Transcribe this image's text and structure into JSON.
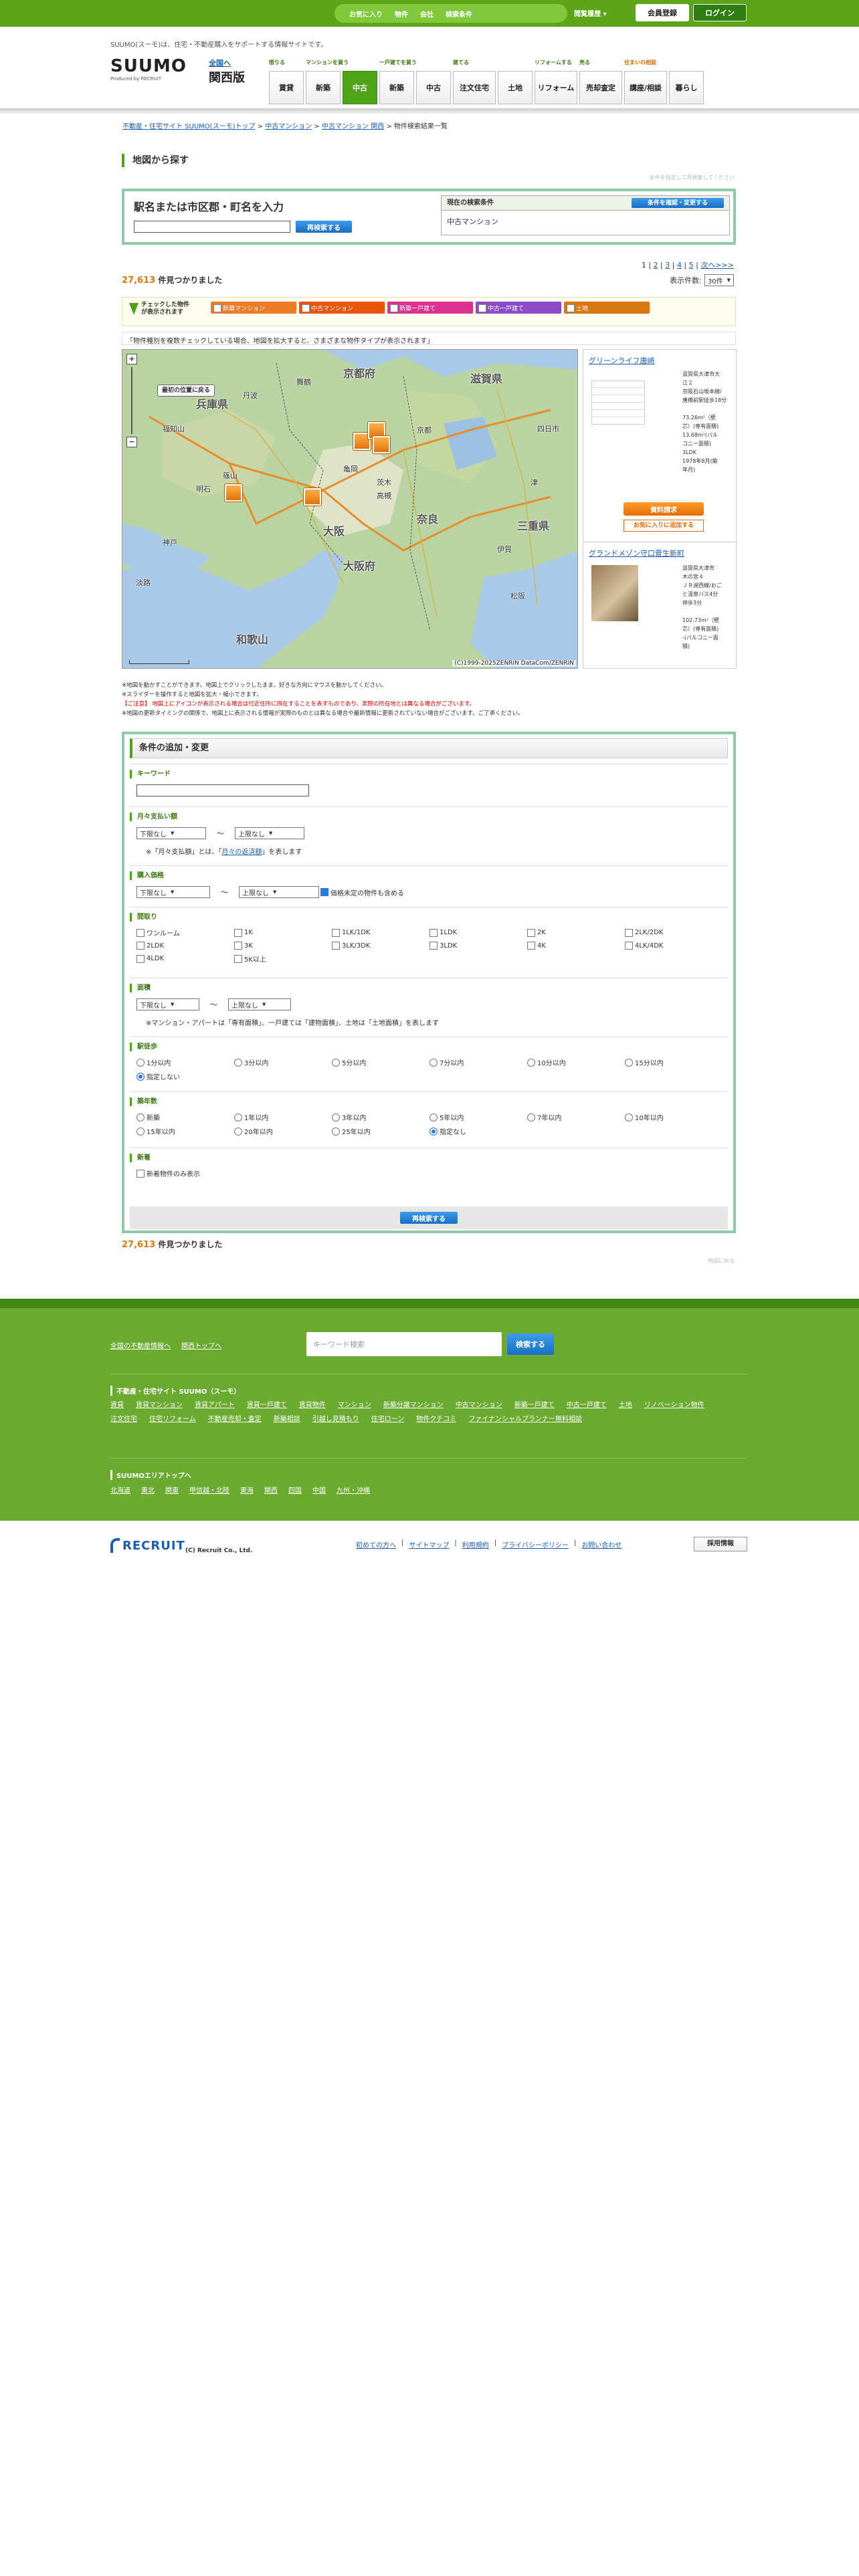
{
  "topbar": {
    "favorites": "お気に入り",
    "properties": "物件",
    "companies": "会社",
    "conditions": "検索条件",
    "history": "閲覧履歴",
    "register": "会員登録",
    "login": "ログイン"
  },
  "header": {
    "tagline": "SUUMO(スーモ)は、住宅・不動産購入をサポートする情報サイトです。",
    "logo": "SUUMO",
    "logo_sub": "Produced by RECRUIT",
    "region_link": "全国へ",
    "region": "関西版"
  },
  "nav": [
    {
      "caption": "借りる",
      "items": [
        "賃貸"
      ]
    },
    {
      "caption": "マンションを買う",
      "items": [
        "新築",
        "中古"
      ]
    },
    {
      "caption": "一戸建てを買う",
      "items": [
        "新築",
        "中古"
      ]
    },
    {
      "caption": "建てる",
      "items": [
        "注文住宅",
        "土地"
      ]
    },
    {
      "caption": "リフォームする",
      "items": [
        "リフォーム"
      ]
    },
    {
      "caption": "売る",
      "items": [
        "売却査定"
      ]
    },
    {
      "caption": "住まいの相談",
      "items": [
        "講座/相談"
      ]
    },
    {
      "caption": "",
      "items": [
        "暮らし"
      ]
    }
  ],
  "breadcrumb": {
    "items": [
      "不動産・住宅サイト SUUMO(スーモ)トップ",
      "中古マンション",
      "中古マンション 関西"
    ],
    "current": "物件検索結果一覧"
  },
  "section": {
    "title": "地図から探す",
    "hint": "条件を指定して再検索してください"
  },
  "search": {
    "label": "駅名または市区郡・町名を入力",
    "button": "再検索する",
    "current_header": "現在の検索条件",
    "change_button": "条件を確認・変更する",
    "current_value": "中古マンション"
  },
  "pager": {
    "pages": [
      "1",
      "2",
      "3",
      "4",
      "5"
    ],
    "next": "次へ>>>"
  },
  "results": {
    "count": "27,613",
    "count_suffix": "件見つかりました",
    "per_page_label": "表示件数:",
    "per_page": "30件"
  },
  "typebar": {
    "label": "チェックした物件が表示されます",
    "chips": [
      "新築マンション",
      "中古マンション",
      "新築一戸建て",
      "中古一戸建て",
      "土地"
    ],
    "chip_colors": [
      "#f07b27",
      "#e8550d",
      "#d9338f",
      "#8c4bc8",
      "#d9770f"
    ]
  },
  "map_note": "「物件種別を複数チェックしている場合、地図を拡大すると、さまざまな物件タイプが表示されます」",
  "map": {
    "reset_button": "最初の位置に戻る",
    "copyright": "(C)1999-2025ZENRIN DataCom/ZENRIN",
    "place_labels": [
      "京都府",
      "兵庫県",
      "大阪",
      "奈良",
      "和歌山",
      "大阪府",
      "三重県",
      "滋賀県",
      "福知山",
      "舞鶴",
      "篠山",
      "京都",
      "神戸",
      "亀岡",
      "茨木",
      "高槻",
      "四日市",
      "津",
      "伊賀",
      "松阪",
      "丹波",
      "明石",
      "淡路"
    ],
    "markers": [
      {
        "lat": 35.02,
        "lng": 135.72
      },
      {
        "lat": 35.08,
        "lng": 135.78
      },
      {
        "lat": 35.0,
        "lng": 135.8
      },
      {
        "lat": 34.72,
        "lng": 135.2
      },
      {
        "lat": 34.7,
        "lng": 135.52
      }
    ]
  },
  "properties": [
    {
      "name": "グリーンライフ唐崎",
      "details": [
        "滋賀県大津市大",
        "江２",
        "京阪石山坂本線/",
        "唐橋前駅徒歩18分",
        "",
        "73.26m²（壁",
        "芯）(専有面積)",
        "13.68m²(バル",
        "コニー面積)",
        "3LDK",
        "1978年8月(築",
        "年月)"
      ],
      "button1": "資料請求",
      "button2": "お気に入りに追加する"
    },
    {
      "name": "グランドメゾン守口菅生新町",
      "details": [
        "滋賀県大津市",
        "木の宮４",
        "ＪＲ湖西線/おご",
        "と温泉バス4分",
        "停歩3分",
        "",
        "102.73m²（壁",
        "芯）(専有面積)",
        "-(バルコニー面",
        "積)"
      ]
    }
  ],
  "notes": [
    "※地図を動かすことができます。地図上でクリックしたまま、好きな方向にマウスを動かしてください。",
    "※スライダーを操作すると地図を拡大・縮小できます。",
    "【ご注意】 地図上にアイコンが表示される場合は付近住所に所在することを表すものであり、実際の所在地とは異なる場合がございます。",
    "※地図の更新タイミングの関係で、地図上に表示される情報が実際のものとは異なる場合や最新情報に更新されていない場合がございます。ご了承ください。"
  ],
  "form": {
    "title": "条件の追加・変更",
    "keyword_label": "キーワード",
    "monthly_label": "月々支払い額",
    "monthly_min": "下限なし",
    "monthly_max": "上限なし",
    "monthly_note_prefix": "※「月々支払額」とは、「",
    "monthly_note_link": "月々の返済額",
    "monthly_note_suffix": "」を表します",
    "price_label": "購入価格",
    "price_min": "下限なし",
    "price_max": "上限なし",
    "price_undecided": "価格未定の物件も含める",
    "layout_label": "間取り",
    "layouts": [
      "ワンルーム",
      "1K",
      "1LK/1DK",
      "1LDK",
      "2K",
      "2LK/2DK",
      "2LDK",
      "3K",
      "3LK/3DK",
      "3LDK",
      "4K",
      "4LK/4DK",
      "4LDK",
      "5K以上"
    ],
    "area_label": "面積",
    "area_min": "下限なし",
    "area_max": "上限なし",
    "area_note": "※マンション・アパートは「専有面積」、一戸建ては「建物面積」、土地は「土地面積」を表します",
    "walk_label": "駅徒歩",
    "walk": [
      "1分以内",
      "3分以内",
      "5分以内",
      "7分以内",
      "10分以内",
      "15分以内",
      "指定しない"
    ],
    "walk_selected": 6,
    "age_label": "築年数",
    "ages": [
      "新築",
      "1年以内",
      "3年以内",
      "5年以内",
      "7年以内",
      "10年以内",
      "15年以内",
      "20年以内",
      "25年以内",
      "指定なし"
    ],
    "age_selected": 9,
    "new_label": "新着",
    "new_only": "新着物件のみ表示",
    "submit": "再検索する"
  },
  "page_top": "地図に戻る",
  "footer": {
    "links_top": [
      "全国の不動産情報へ",
      "関西トップへ"
    ],
    "search_placeholder": "キーワード検索",
    "search_button": "検索する",
    "site_heading": "不動産・住宅サイト SUUMO（スーモ）",
    "site_links": [
      "賃貸",
      "賃貸マンション",
      "賃貸アパート",
      "賃貸一戸建て",
      "賃貸物件",
      "マンション",
      "新築分譲マンション",
      "中古マンション",
      "新築一戸建て",
      "中古一戸建て",
      "土地",
      "リノベーション物件",
      "注文住宅",
      "住宅リフォーム",
      "不動産売却・査定",
      "新築相談",
      "引越し見積もり",
      "住宅ローン",
      "物件クチコミ",
      "ファイナンシャルプランナー無料相談"
    ],
    "regions_heading": "SUUMOエリアトップへ",
    "regions": [
      "北海道",
      "東北",
      "関東",
      "甲信越・北陸",
      "東海",
      "関西",
      "四国",
      "中国",
      "九州・沖縄"
    ]
  },
  "bottom": {
    "company": "RECRUIT",
    "copyright": "(C) Recruit Co., Ltd.",
    "links": [
      "初めての方へ",
      "サイトマップ",
      "利用規約",
      "プライバシーポリシー",
      "お問い合わせ"
    ],
    "recruit_button": "採用情報"
  }
}
